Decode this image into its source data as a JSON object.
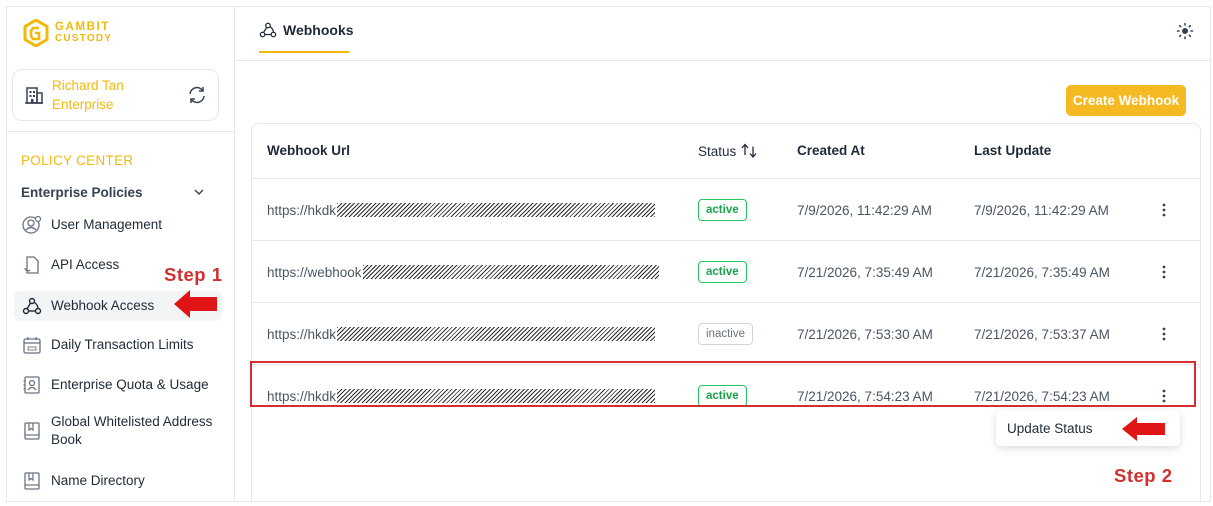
{
  "brand": {
    "line1": "GAMBIT",
    "line2": "CUSTODY"
  },
  "account": {
    "name_line1": "Richard Tan",
    "name_line2": "Enterprise"
  },
  "sidebar": {
    "section_title": "POLICY CENTER",
    "group_title": "Enterprise Policies",
    "items": [
      {
        "label": "User Management",
        "icon": "user-gear-icon"
      },
      {
        "label": "API Access",
        "icon": "api-document-icon"
      },
      {
        "label": "Webhook Access",
        "icon": "webhook-icon"
      },
      {
        "label": "Daily Transaction Limits",
        "icon": "calendar-icon"
      },
      {
        "label": "Enterprise Quota & Usage",
        "icon": "quota-user-icon"
      },
      {
        "label": "Global Whitelisted Address Book",
        "icon": "address-book-icon"
      },
      {
        "label": "Name Directory",
        "icon": "directory-book-icon"
      }
    ]
  },
  "header": {
    "tab_label": "Webhooks"
  },
  "toolbar": {
    "create_label": "Create Webhook"
  },
  "table": {
    "columns": [
      "Webhook Url",
      "Status",
      "Created At",
      "Last Update"
    ],
    "rows": [
      {
        "url": "https://hkdk",
        "status": "active",
        "created": "7/9/2026, 11:42:29 AM",
        "updated": "7/9/2026, 11:42:29 AM"
      },
      {
        "url": "https://webhook",
        "status": "active",
        "created": "7/21/2026, 7:35:49 AM",
        "updated": "7/21/2026, 7:35:49 AM"
      },
      {
        "url": "https://hkdk",
        "status": "inactive",
        "created": "7/21/2026, 7:53:30 AM",
        "updated": "7/21/2026, 7:53:37 AM"
      },
      {
        "url": "https://hkdk",
        "status": "active",
        "created": "7/21/2026, 7:54:23 AM",
        "updated": "7/21/2026, 7:54:23 AM"
      }
    ]
  },
  "context_menu": {
    "item": "Update Status"
  },
  "annotations": {
    "step1": "Step 1",
    "step2": "Step 2"
  },
  "colors": {
    "accent": "#f0b90b",
    "button": "#f5b921",
    "annotation": "#d32f2f",
    "active": "#16a34a"
  }
}
